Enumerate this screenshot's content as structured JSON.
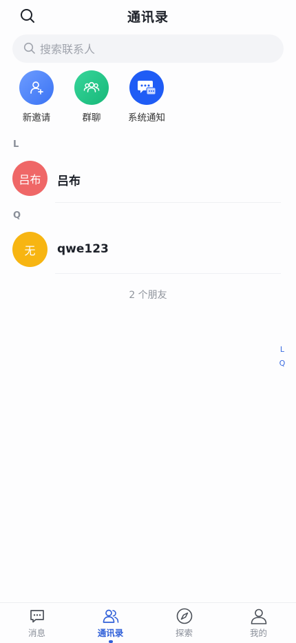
{
  "header": {
    "title": "通讯录",
    "search_icon": "search-icon"
  },
  "search": {
    "placeholder": "搜索联系人"
  },
  "quick_entries": [
    {
      "label": "新邀请",
      "icon": "add-user-icon",
      "color": "#4f86f7"
    },
    {
      "label": "群聊",
      "icon": "group-icon",
      "color": "#22c486"
    },
    {
      "label": "系统通知",
      "icon": "chat-bubble-icon",
      "color": "#1f5cf5"
    }
  ],
  "sections": [
    {
      "letter": "L",
      "contacts": [
        {
          "avatar_text": "吕布",
          "name": "吕布",
          "avatar_color": "#ef6767"
        }
      ]
    },
    {
      "letter": "Q",
      "contacts": [
        {
          "avatar_text": "无",
          "name": "qwe123",
          "avatar_color": "#f7b512"
        }
      ]
    }
  ],
  "friend_count": "2 个朋友",
  "index_letters": [
    "L",
    "Q"
  ],
  "tabs": [
    {
      "label": "消息",
      "icon": "message-icon",
      "active": false
    },
    {
      "label": "通讯录",
      "icon": "contacts-icon",
      "active": true
    },
    {
      "label": "探索",
      "icon": "compass-icon",
      "active": false
    },
    {
      "label": "我的",
      "icon": "profile-icon",
      "active": false
    }
  ],
  "colors": {
    "accent": "#2f5fd8",
    "text_muted": "#8a8f99"
  }
}
